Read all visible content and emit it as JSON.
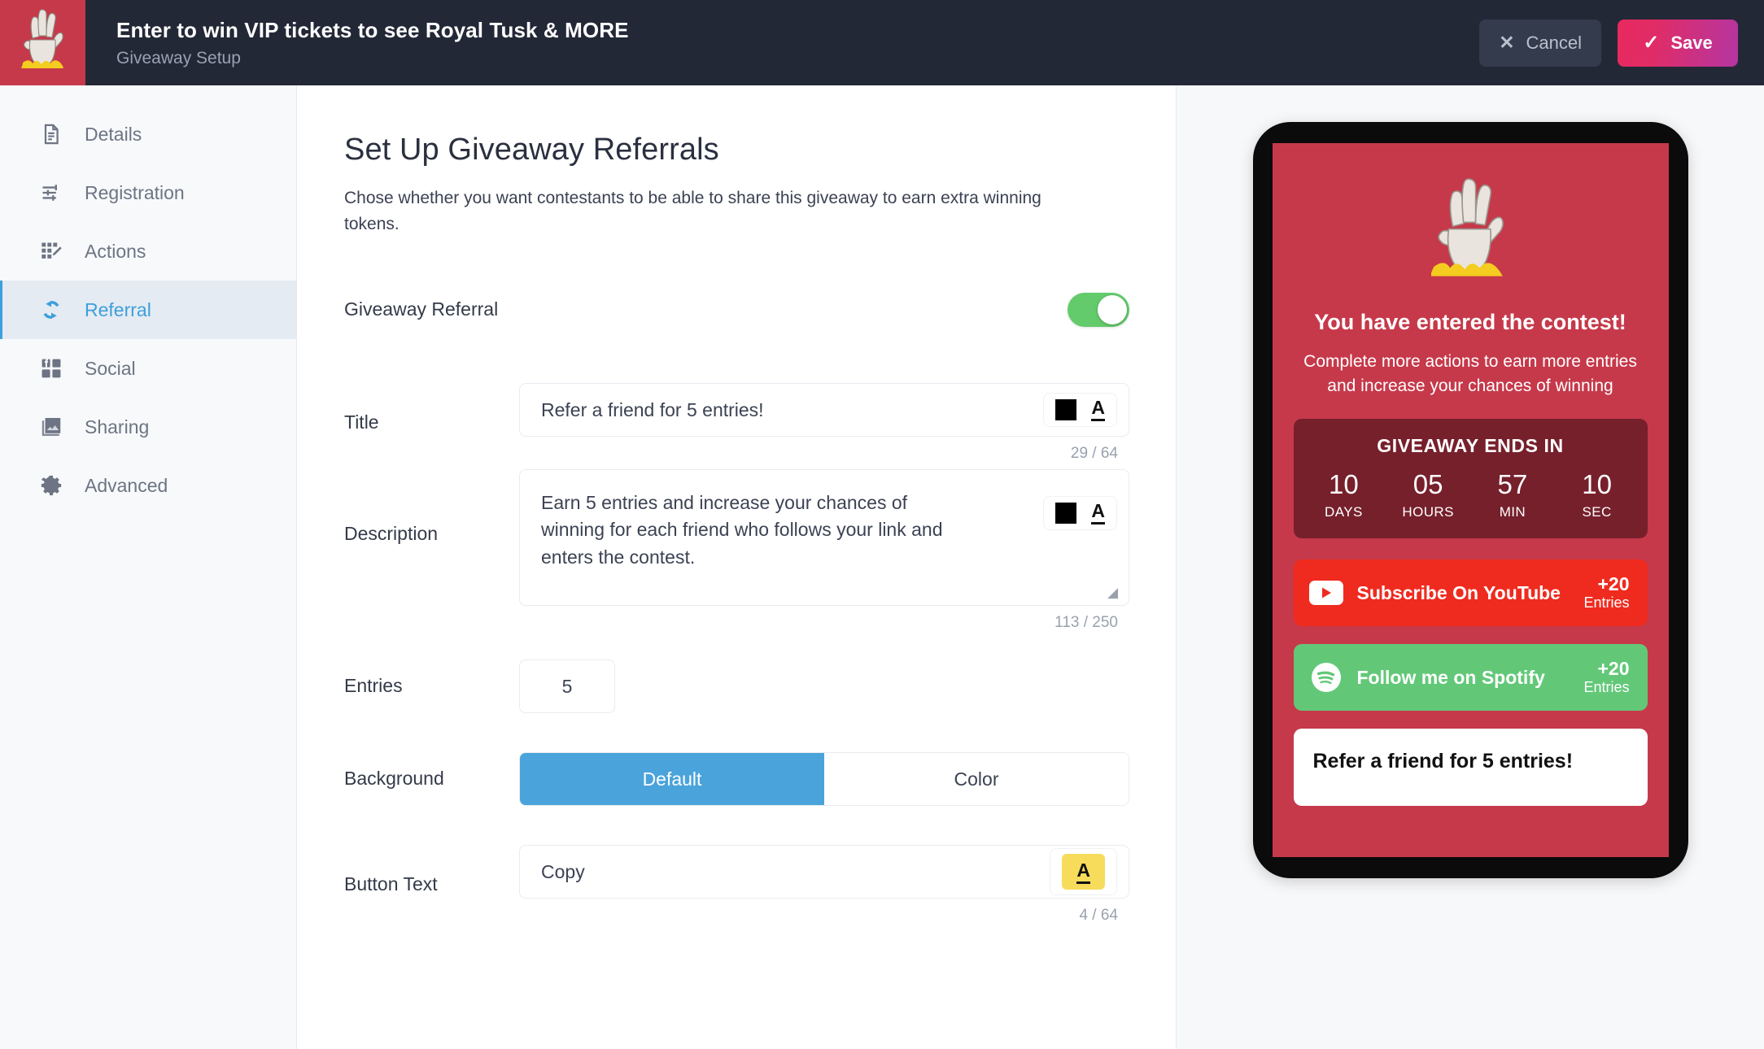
{
  "topbar": {
    "title": "Enter to win VIP tickets to see Royal Tusk & MORE",
    "subtitle": "Giveaway Setup",
    "cancel_label": "Cancel",
    "save_label": "Save",
    "cancel_icon": "close-icon",
    "save_icon": "check-icon",
    "brand_icon": "zombie-hand-logo",
    "bg_color": "#232837",
    "brand_bg": "#C6394A",
    "save_gradient_from": "#E8295E",
    "save_gradient_to": "#B435A0"
  },
  "sidebar": {
    "items": [
      {
        "label": "Details",
        "icon": "document-icon",
        "active": false
      },
      {
        "label": "Registration",
        "icon": "sliders-icon",
        "active": false
      },
      {
        "label": "Actions",
        "icon": "checklist-pencil-icon",
        "active": false
      },
      {
        "label": "Referral",
        "icon": "refresh-cycle-icon",
        "active": true
      },
      {
        "label": "Social",
        "icon": "social-grid-icon",
        "active": false
      },
      {
        "label": "Sharing",
        "icon": "image-stack-icon",
        "active": false
      },
      {
        "label": "Advanced",
        "icon": "gear-icon",
        "active": false
      }
    ],
    "active_color": "#3E9FDC",
    "active_bg": "#E4EBF2"
  },
  "main": {
    "page_title": "Set Up Giveaway Referrals",
    "page_desc": "Chose whether you want contestants to be able to share this giveaway to earn extra winning tokens.",
    "giveaway_referral": {
      "label": "Giveaway Referral",
      "enabled": true,
      "toggle_color": "#63CB6C"
    },
    "title_field": {
      "label": "Title",
      "value": "Refer a friend for 5 entries!",
      "counter": "29 / 64",
      "color_swatch": "#000000",
      "color_swatch_icon": "color-swatch-icon",
      "text_color_icon": "text-color-A-icon",
      "text_color": "#000000"
    },
    "description_field": {
      "label": "Description",
      "value": "Earn 5 entries and increase your chances of winning for each friend who follows your link and enters the contest.",
      "counter": "113 / 250",
      "color_swatch": "#000000",
      "color_swatch_icon": "color-swatch-icon",
      "text_color_icon": "text-color-A-icon"
    },
    "entries_field": {
      "label": "Entries",
      "value": "5"
    },
    "background_field": {
      "label": "Background",
      "options": [
        "Default",
        "Color"
      ],
      "selected": "Default",
      "selected_color": "#4AA3DB"
    },
    "button_text_field": {
      "label": "Button Text",
      "value": "Copy",
      "counter": "4 / 64",
      "text_color_icon": "text-color-A-icon",
      "chip_bg": "#F7DC5C"
    }
  },
  "preview": {
    "panel_bg": "#F7F8FA",
    "screen_bg": "#C6394A",
    "hero_icon": "zombie-hand-illustration",
    "title": "You have entered the contest!",
    "subtitle": "Complete more actions to earn more entries and increase your chances of winning",
    "countdown": {
      "heading": "GIVEAWAY ENDS IN",
      "bg": "#76202C",
      "units": [
        {
          "value": "10",
          "label": "DAYS"
        },
        {
          "value": "05",
          "label": "HOURS"
        },
        {
          "value": "57",
          "label": "MIN"
        },
        {
          "value": "10",
          "label": "SEC"
        }
      ]
    },
    "actions": [
      {
        "label": "Subscribe On YouTube",
        "plus": "+20",
        "entries_label": "Entries",
        "icon": "youtube-icon",
        "bg": "#EF2B1F"
      },
      {
        "label": "Follow me on Spotify",
        "plus": "+20",
        "entries_label": "Entries",
        "icon": "spotify-icon",
        "bg": "#62C878"
      }
    ],
    "referral_card": {
      "title": "Refer a friend for 5 entries!"
    }
  }
}
